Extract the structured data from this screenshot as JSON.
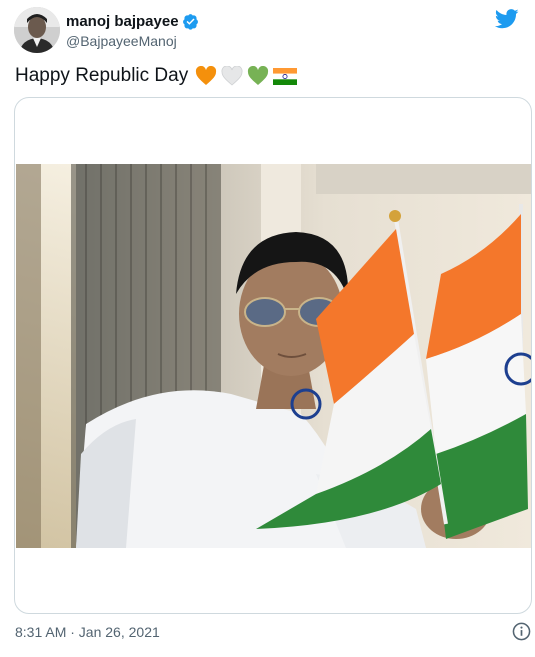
{
  "author": {
    "name": "manoj bajpayee",
    "handle": "@BajpayeeManoj"
  },
  "tweet": {
    "text": "Happy Republic Day",
    "emojis": [
      "orange-heart",
      "white-heart",
      "green-heart",
      "india-flag"
    ]
  },
  "meta": {
    "timestamp": "8:31 AM · Jan 26, 2021"
  },
  "icons": {
    "brand": "twitter-bird-icon",
    "verified": "verified-badge-icon",
    "info": "info-icon"
  },
  "colors": {
    "twitter_blue": "#1d9bf0",
    "saffron": "#ff9933",
    "india_green": "#138808",
    "text_secondary": "#536471"
  }
}
